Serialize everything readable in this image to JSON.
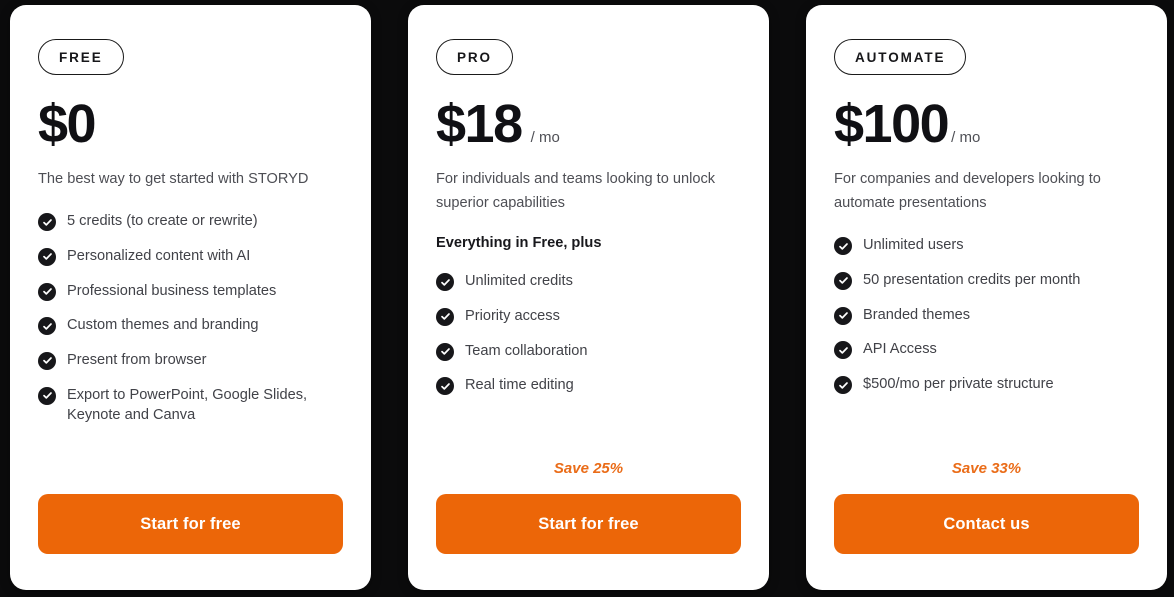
{
  "theme": {
    "page_background": "#0b0b0c",
    "card_background": "#ffffff",
    "accent_orange": "#ec6608",
    "save_note_orange": "#ea6c18",
    "check_circle": "#17171a",
    "body_text": "#414248"
  },
  "plans": [
    {
      "badge": "FREE",
      "price": "$0",
      "period": "",
      "description": "The best way to get started with STORYD",
      "note": "",
      "features": [
        "5 credits (to create or rewrite)",
        "Personalized content with AI",
        "Professional business templates",
        "Custom themes and branding",
        "Present from browser",
        "Export to PowerPoint, Google Slides, Keynote and Canva"
      ],
      "save_note": "",
      "cta_label": "Start for free",
      "check_icon": "check-circle-icon"
    },
    {
      "badge": "PRO",
      "price": "$18",
      "period": "/ mo",
      "description": "For individuals and teams looking to unlock superior  capabilities",
      "note": "Everything in Free, plus",
      "features": [
        "Unlimited credits",
        "Priority access",
        "Team collaboration",
        "Real time editing"
      ],
      "save_note": "Save 25%",
      "cta_label": "Start for free",
      "check_icon": "check-circle-icon"
    },
    {
      "badge": "AUTOMATE",
      "price": "$100",
      "period": "/ mo",
      "description": "For companies and developers looking to automate presentations",
      "note": "",
      "features": [
        "Unlimited users",
        "50 presentation credits per month",
        "Branded themes",
        "API Access",
        "$500/mo per private structure"
      ],
      "save_note": "Save 33%",
      "cta_label": "Contact us",
      "check_icon": "check-circle-icon"
    }
  ]
}
